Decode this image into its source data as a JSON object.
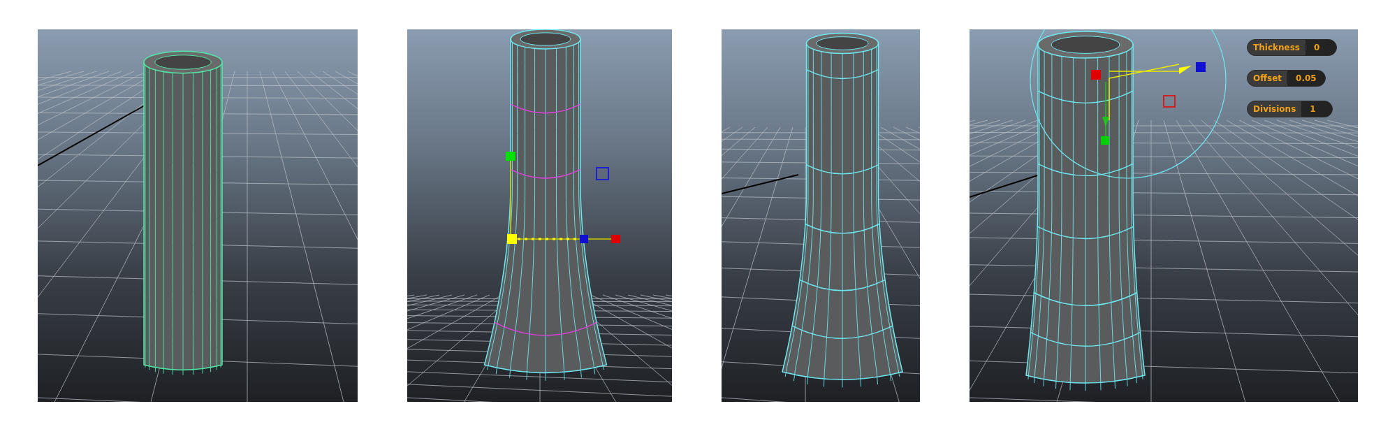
{
  "viewports": [
    {
      "kind": "tube"
    },
    {
      "kind": "flared-selected"
    },
    {
      "kind": "flared"
    },
    {
      "kind": "flared-extrude",
      "hud": [
        {
          "label": "Thickness",
          "value": "0"
        },
        {
          "label": "Offset",
          "value": "0.05"
        },
        {
          "label": "Divisions",
          "value": "1"
        }
      ]
    }
  ]
}
